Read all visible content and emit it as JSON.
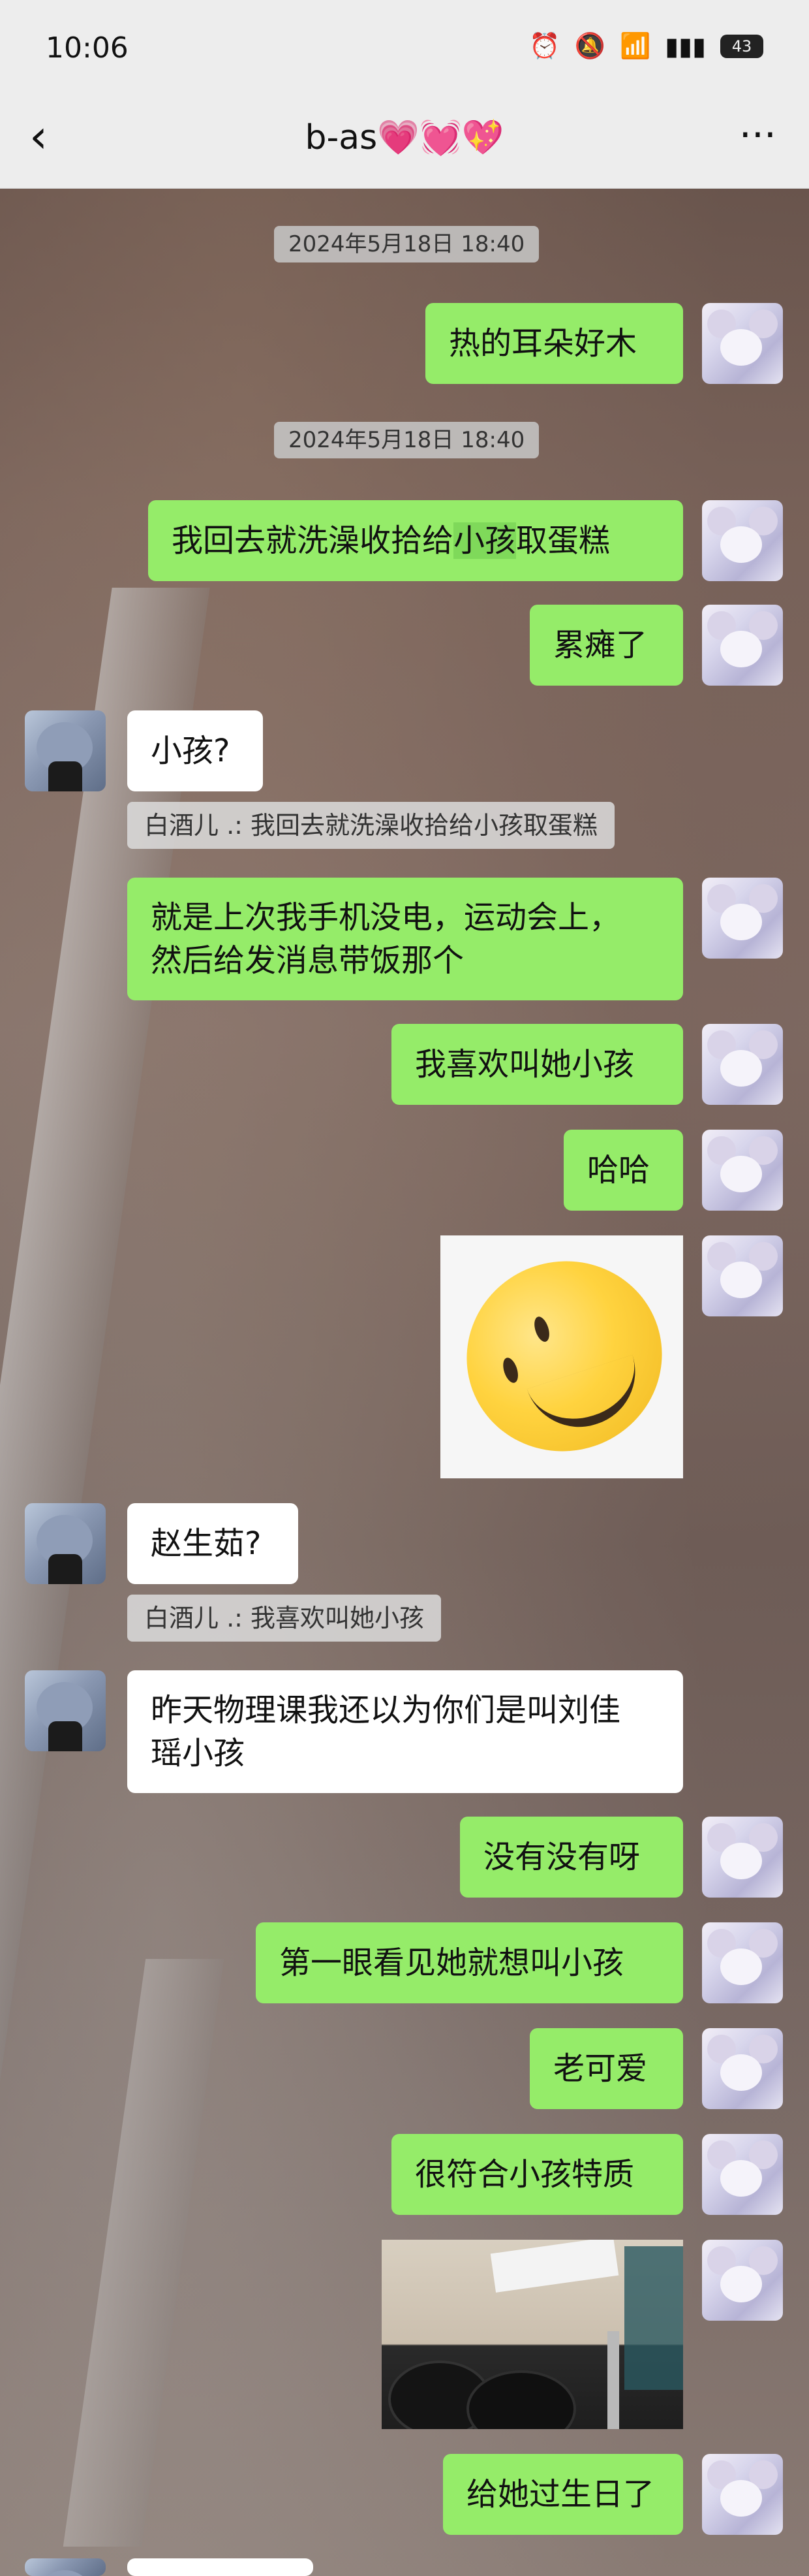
{
  "status_bar": {
    "time": "10:06",
    "icons": [
      "alarm-icon",
      "mute-icon",
      "wifi-icon",
      "signal-5g-icon",
      "battery-icon"
    ],
    "battery": "43"
  },
  "nav": {
    "back_icon": "‹",
    "title": "b-as💗💓💖",
    "more_icon": "···"
  },
  "messages": {
    "ts1": "2024年5月18日 18:40",
    "m1": "热的耳朵好木",
    "ts2": "2024年5月18日 18:40",
    "m2_before": "我回去就洗澡收拾给",
    "m2_highlight": "小孩",
    "m2_after": "取蛋糕",
    "m3": "累瘫了",
    "m4": "小孩?",
    "q4": "白酒儿 .:  我回去就洗澡收拾给小孩取蛋糕",
    "m5_line1": "就是上次我手机没电，运动会上，",
    "m5_line2": "然后给发消息带饭那个",
    "m6": "我喜欢叫她小孩",
    "m7": "哈哈",
    "m8": "赵生茹?",
    "q8": "白酒儿 .:  我喜欢叫她小孩",
    "m9_line1": "昨天物理课我还以为你们是叫刘佳",
    "m9_line2": "瑶小孩",
    "m10": "没有没有呀",
    "m11": "第一眼看见她就想叫小孩",
    "m12": "老可爱",
    "m13": "很符合小孩特质",
    "m14": "给她过生日了"
  }
}
